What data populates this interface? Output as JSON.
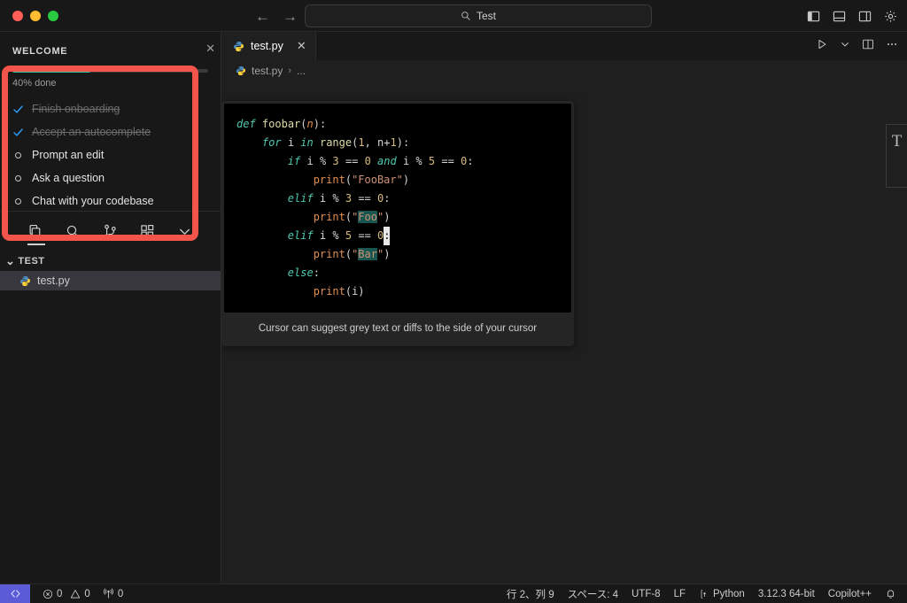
{
  "titlebar": {
    "traffic_lights": [
      "close",
      "minimize",
      "zoom"
    ],
    "nav_back": "←",
    "nav_forward": "→",
    "search": {
      "icon": "search-icon",
      "value": "Test"
    },
    "right_icons": [
      "toggle-primary-sidebar-icon",
      "toggle-panel-icon",
      "toggle-secondary-sidebar-icon",
      "gear-icon"
    ]
  },
  "welcome": {
    "title": "WELCOME",
    "close_label": "✕",
    "progress_percent": 40,
    "progress_label": "40% done",
    "tasks": [
      {
        "label": "Finish onboarding",
        "done": true
      },
      {
        "label": "Accept an autocomplete",
        "done": true
      },
      {
        "label": "Prompt an edit",
        "done": false
      },
      {
        "label": "Ask a question",
        "done": false
      },
      {
        "label": "Chat with your codebase",
        "done": false
      }
    ]
  },
  "activitybar": {
    "items": [
      {
        "name": "explorer",
        "active": true
      },
      {
        "name": "search",
        "active": false
      },
      {
        "name": "source-control",
        "active": false
      },
      {
        "name": "extensions",
        "active": false
      },
      {
        "name": "more",
        "active": false
      }
    ]
  },
  "explorer": {
    "folder_label": "TEST",
    "chevron": "⌄",
    "files": [
      {
        "label": "test.py",
        "selected": true
      }
    ]
  },
  "editor": {
    "tab": {
      "label": "test.py",
      "close": "✕"
    },
    "toolbar_icons": [
      "run-icon",
      "chevron-down-icon",
      "split-editor-icon",
      "more-actions-icon"
    ],
    "breadcrumb": {
      "file": "test.py",
      "separator": "›",
      "rest": "..."
    },
    "hint": "Cursor can suggest grey text or diffs to the side of your cursor",
    "code_lines": [
      "def foobar(n):",
      "    for i in range(1, n+1):",
      "        if i % 3 == 0 and i % 5 == 0:",
      "            print(\"FooBar\")",
      "        elif i % 3 == 0:",
      "            print(\"Foo\")",
      "        elif i % 5 == 0:",
      "            print(\"Bar\")",
      "        else:",
      "            print(i)"
    ]
  },
  "right_panel": {
    "glyph": "T"
  },
  "statusbar": {
    "remote_icon": "remote-window-icon",
    "errors_icon": "error-icon",
    "errors": "0",
    "warnings_icon": "warning-icon",
    "warnings": "0",
    "ports_icon": "radio-tower-icon",
    "ports": "0",
    "cursor_position": "行 2、列 9",
    "indentation": "スペース: 4",
    "encoding": "UTF-8",
    "eol": "LF",
    "language_icon": "python-icon",
    "language": "Python",
    "interpreter": "3.12.3 64-bit",
    "copilot": "Copilot++",
    "bell_icon": "bell-icon"
  },
  "annotation": {
    "color": "#f4554a"
  }
}
